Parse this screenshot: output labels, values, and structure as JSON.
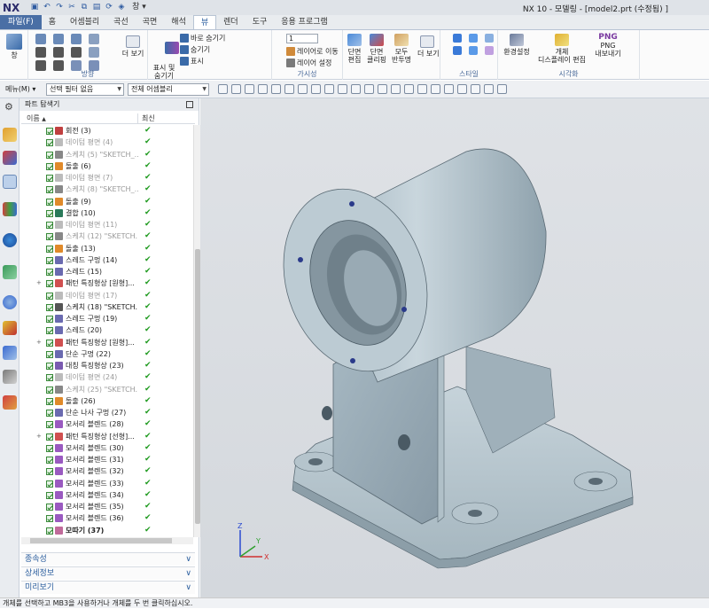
{
  "app": {
    "logo": "NX",
    "window_title": "NX 10 - 모델링 - [model2.prt (수정됨) ]"
  },
  "quick_access": {
    "window_menu": "창 ▾"
  },
  "menubar": {
    "items": [
      "파일(F)",
      "홈",
      "어셈블리",
      "곡선",
      "곡면",
      "해석",
      "뷰",
      "렌더",
      "도구",
      "응용 프로그램"
    ],
    "active": "뷰"
  },
  "ribbon": {
    "window": "창",
    "orient_label": "방향",
    "more_view": "더 보기",
    "show_hide": "표시 및\n숨기기",
    "hide_opts": [
      "바로 숨기기",
      "숨기기",
      "표시"
    ],
    "layer_num": "1",
    "layer_move": "레이어로 이동",
    "layer_setting": "레이어 설정",
    "visibility_label": "가시성",
    "section_edit": "단면\n편집",
    "section_clip": "단면\n클리핑",
    "all_invert": "모두\n반투명",
    "more": "더 보기",
    "style_label": "스타일",
    "env_setting": "환경설정",
    "object_display": "개체\n디스플레이 편집",
    "png_title": "PNG",
    "png_export": "PNG\n내보내기",
    "visual_label": "시각화"
  },
  "selbar": {
    "menu": "메뉴(M) ▾",
    "filter": "선택 필터 없음",
    "assembly": "전체 어셈블리"
  },
  "navigator": {
    "title": "파트 탐색기",
    "col_name": "이름",
    "col_latest": "최신",
    "items": [
      {
        "label": "회전 (3)",
        "dim": false,
        "icon": "#c04040"
      },
      {
        "label": "데이텀 평면 (4)",
        "dim": true,
        "icon": "#bbbbbb"
      },
      {
        "label": "스케치 (5) \"SKETCH_...",
        "dim": true,
        "icon": "#888888"
      },
      {
        "label": "돌출 (6)",
        "dim": false,
        "icon": "#e08a2a"
      },
      {
        "label": "데이텀 평면 (7)",
        "dim": true,
        "icon": "#bbbbbb"
      },
      {
        "label": "스케치 (8) \"SKETCH_...",
        "dim": true,
        "icon": "#888888"
      },
      {
        "label": "돌출 (9)",
        "dim": false,
        "icon": "#e08a2a"
      },
      {
        "label": "결합 (10)",
        "dim": false,
        "icon": "#2a7a5a"
      },
      {
        "label": "데이텀 평면 (11)",
        "dim": true,
        "icon": "#bbbbbb"
      },
      {
        "label": "스케치 (12) \"SKETCH...",
        "dim": true,
        "icon": "#888888"
      },
      {
        "label": "돌출 (13)",
        "dim": false,
        "icon": "#e08a2a"
      },
      {
        "label": "스레드 구멍 (14)",
        "dim": false,
        "icon": "#6a6ab0"
      },
      {
        "label": "스레드 (15)",
        "dim": false,
        "icon": "#6a6ab0"
      },
      {
        "label": "패턴 특징형상 [원형]...",
        "dim": false,
        "icon": "#d05050",
        "expand": true
      },
      {
        "label": "데이텀 평면 (17)",
        "dim": true,
        "icon": "#bbbbbb"
      },
      {
        "label": "스케치 (18) \"SKETCH...",
        "dim": false,
        "icon": "#555555"
      },
      {
        "label": "스레드 구멍 (19)",
        "dim": false,
        "icon": "#6a6ab0"
      },
      {
        "label": "스레드 (20)",
        "dim": false,
        "icon": "#6a6ab0"
      },
      {
        "label": "패턴 특징형상 [원형]...",
        "dim": false,
        "icon": "#d05050",
        "expand": true
      },
      {
        "label": "단순 구멍 (22)",
        "dim": false,
        "icon": "#6a6ab0"
      },
      {
        "label": "대칭 특징형상 (23)",
        "dim": false,
        "icon": "#7a5ab0"
      },
      {
        "label": "데이텀 평면 (24)",
        "dim": true,
        "icon": "#bbbbbb"
      },
      {
        "label": "스케치 (25) \"SKETCH...",
        "dim": true,
        "icon": "#888888"
      },
      {
        "label": "돌출 (26)",
        "dim": false,
        "icon": "#e08a2a"
      },
      {
        "label": "단순 나사 구멍 (27)",
        "dim": false,
        "icon": "#6a6ab0"
      },
      {
        "label": "모서리 블렌드 (28)",
        "dim": false,
        "icon": "#9a5ac0"
      },
      {
        "label": "패턴 특징형상 [선형]...",
        "dim": false,
        "icon": "#d05050",
        "expand": true
      },
      {
        "label": "모서리 블렌드 (30)",
        "dim": false,
        "icon": "#9a5ac0"
      },
      {
        "label": "모서리 블렌드 (31)",
        "dim": false,
        "icon": "#9a5ac0"
      },
      {
        "label": "모서리 블렌드 (32)",
        "dim": false,
        "icon": "#9a5ac0"
      },
      {
        "label": "모서리 블렌드 (33)",
        "dim": false,
        "icon": "#9a5ac0"
      },
      {
        "label": "모서리 블렌드 (34)",
        "dim": false,
        "icon": "#9a5ac0"
      },
      {
        "label": "모서리 블렌드 (35)",
        "dim": false,
        "icon": "#9a5ac0"
      },
      {
        "label": "모서리 블렌드 (36)",
        "dim": false,
        "icon": "#9a5ac0"
      },
      {
        "label": "모따기 (37)",
        "dim": false,
        "icon": "#c06a9a",
        "bold": true
      }
    ],
    "panels": [
      "종속성",
      "상세정보",
      "미리보기"
    ]
  },
  "status": "개체를 선택하고 MB3을 사용하거나 개체를 두 번 클릭하십시오.",
  "colors": {
    "accent": "#4a6fa5",
    "part": "#b8c7cf",
    "bg": "#d8dbe0"
  }
}
